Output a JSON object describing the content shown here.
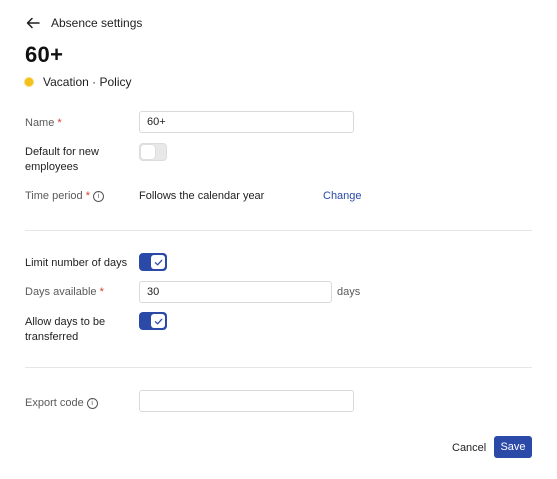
{
  "header": {
    "back_label": "Absence settings",
    "title": "60+",
    "subtitle": "Vacation · Policy"
  },
  "form": {
    "name": {
      "label": "Name",
      "required_mark": "*",
      "value": "60+"
    },
    "default_new": {
      "label": "Default for new employees",
      "enabled": false
    },
    "time_period": {
      "label": "Time period",
      "required_mark": "*",
      "value": "Follows the calendar year",
      "action": "Change"
    },
    "limit_days": {
      "label": "Limit number of days",
      "enabled": true
    },
    "days_available": {
      "label": "Days available",
      "required_mark": "*",
      "value": "30",
      "unit": "days"
    },
    "allow_transfer": {
      "label": "Allow days to be transferred",
      "enabled": true
    },
    "export_code": {
      "label": "Export code",
      "value": ""
    }
  },
  "footer": {
    "cancel_label": "Cancel",
    "save_label": "Save"
  },
  "colors": {
    "accent": "#2b4aa8",
    "required": "#d63b2f",
    "sun_icon": "#f4c01e"
  },
  "icons": {
    "back": "arrow-left-icon",
    "info": "info-icon",
    "policy": "sun-icon",
    "toggle_check": "check-icon"
  }
}
